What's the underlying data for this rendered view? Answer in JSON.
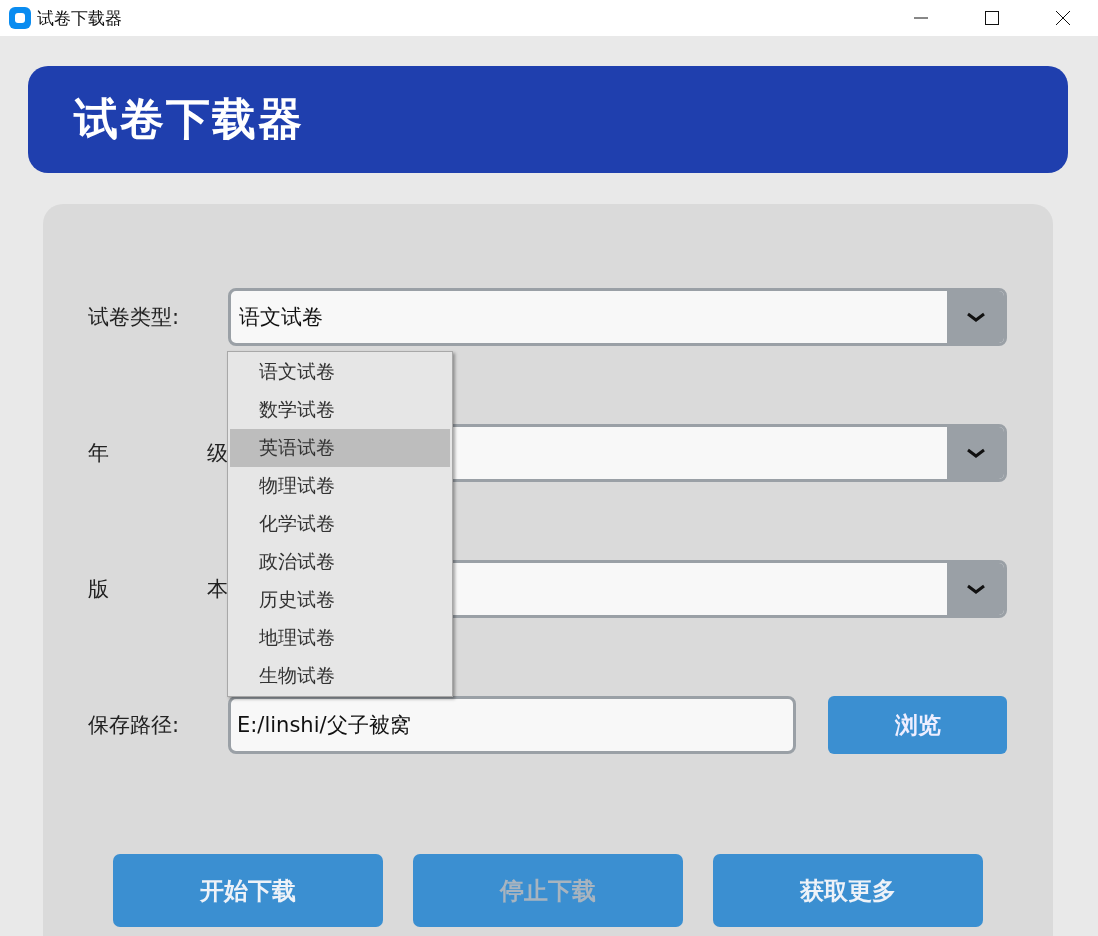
{
  "window": {
    "title": "试卷下载器"
  },
  "header": {
    "title": "试卷下载器"
  },
  "fields": [
    {
      "kind": "combo",
      "label": "试卷类型:",
      "value": "语文试卷",
      "expanded": true,
      "options": [
        {
          "label": "语文试卷",
          "highlighted": false
        },
        {
          "label": "数学试卷",
          "highlighted": false
        },
        {
          "label": "英语试卷",
          "highlighted": true
        },
        {
          "label": "物理试卷",
          "highlighted": false
        },
        {
          "label": "化学试卷",
          "highlighted": false
        },
        {
          "label": "政治试卷",
          "highlighted": false
        },
        {
          "label": "历史试卷",
          "highlighted": false
        },
        {
          "label": "地理试卷",
          "highlighted": false
        },
        {
          "label": "生物试卷",
          "highlighted": false
        }
      ]
    },
    {
      "kind": "combo",
      "label": "年 级",
      "expanded": false
    },
    {
      "kind": "combo",
      "label": "版 本",
      "expanded": false
    },
    {
      "kind": "path",
      "label": "保存路径:",
      "value": "E:/linshi/父子被窝",
      "button": "浏览"
    }
  ],
  "actions": [
    {
      "label": "开始下载",
      "disabled": false
    },
    {
      "label": "停止下载",
      "disabled": true
    },
    {
      "label": "获取更多",
      "disabled": false
    }
  ]
}
